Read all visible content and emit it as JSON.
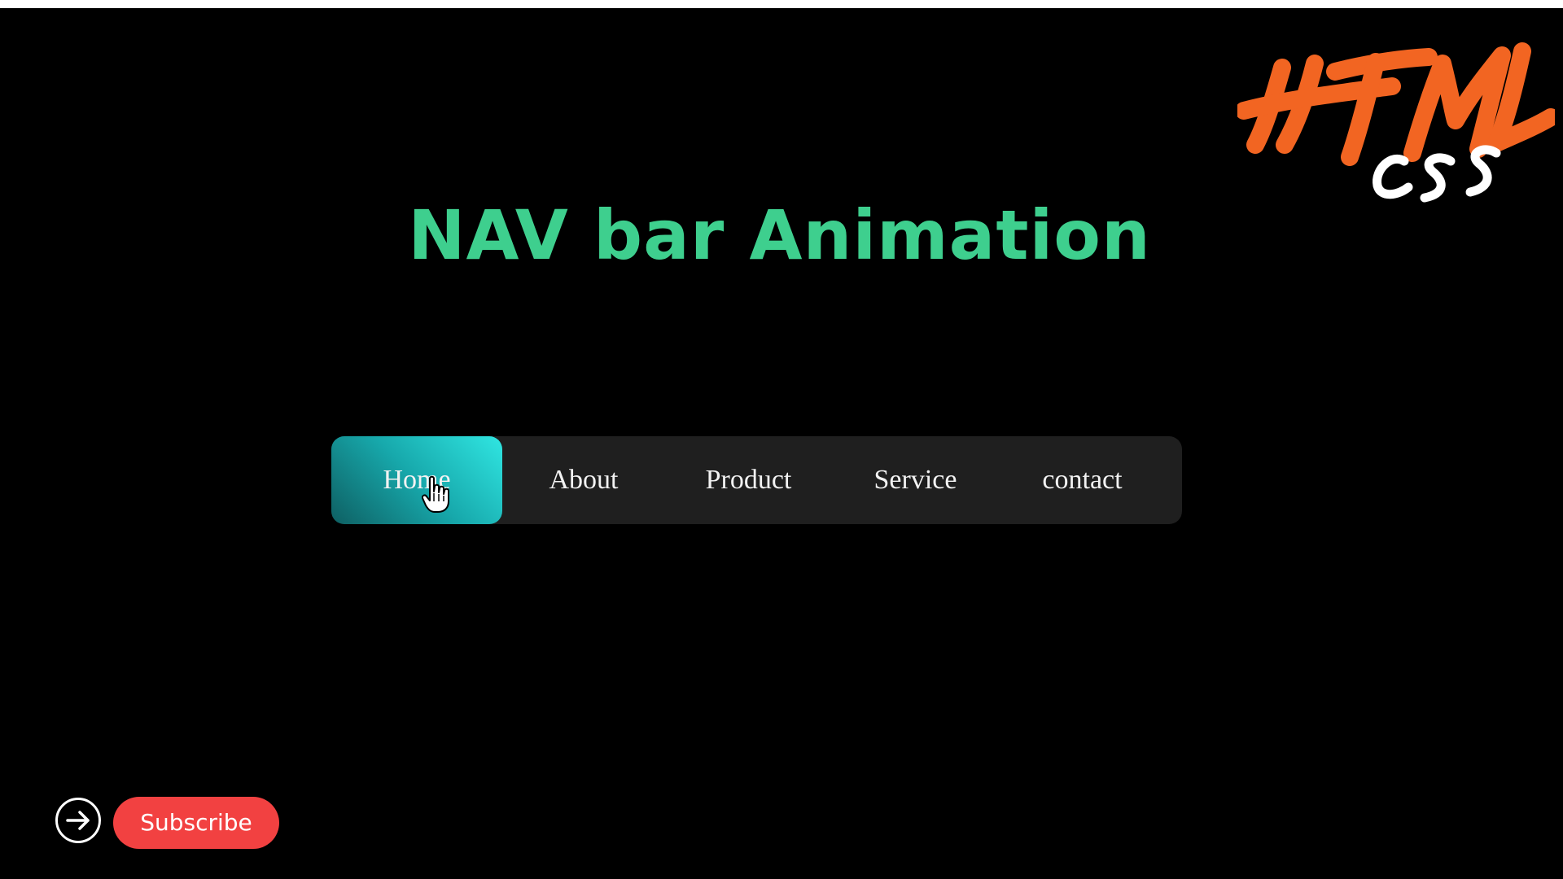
{
  "page": {
    "title": "NAV bar Animation"
  },
  "logo": {
    "primary_text": "HTML",
    "secondary_text": "css",
    "primary_color": "#f26522",
    "secondary_color": "#ffffff"
  },
  "nav": {
    "active_index": 0,
    "items": [
      {
        "label": "Home"
      },
      {
        "label": "About"
      },
      {
        "label": "Product"
      },
      {
        "label": "Service"
      },
      {
        "label": "contact"
      }
    ]
  },
  "subscribe": {
    "label": "Subscribe",
    "icon": "arrow-right-circle-icon"
  },
  "colors": {
    "background": "#000000",
    "title": "#3ecf8e",
    "nav_bg": "#1f1f1f",
    "indicator_gradient": [
      "#0e5f62",
      "#30e6e2"
    ],
    "subscribe_bg": "#f24141"
  }
}
